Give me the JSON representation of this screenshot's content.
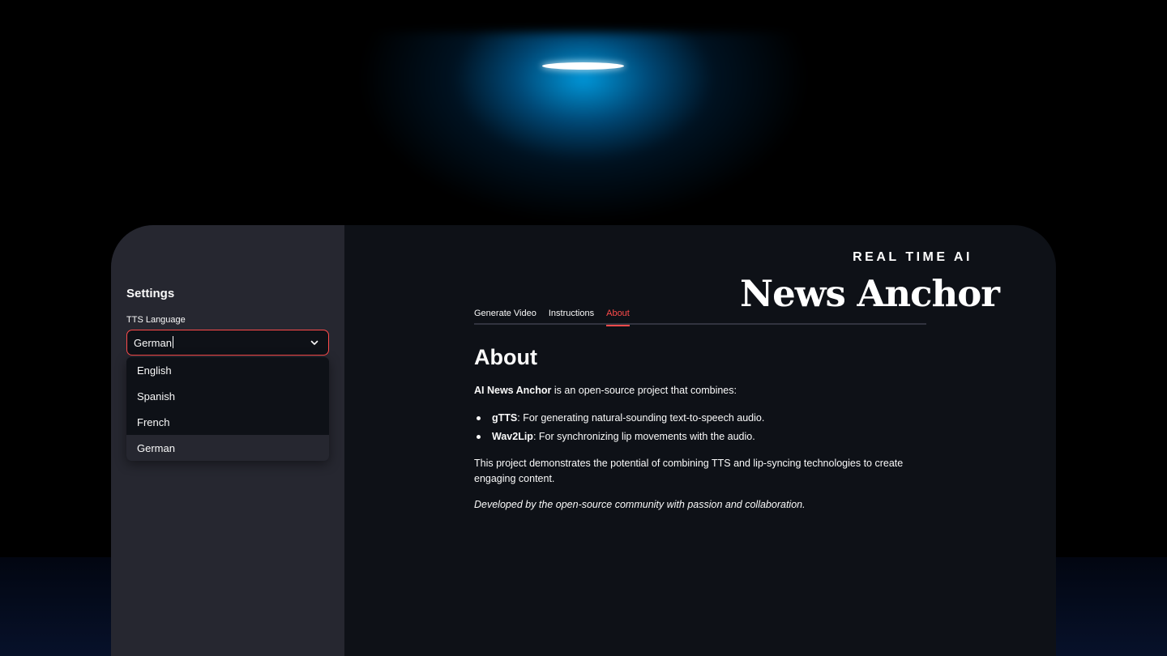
{
  "brand": {
    "kicker": "REAL TIME AI",
    "title": "News Anchor"
  },
  "sidebar": {
    "title": "Settings",
    "select": {
      "label": "TTS Language",
      "value": "German",
      "options": [
        {
          "label": "English",
          "selected": false
        },
        {
          "label": "Spanish",
          "selected": false
        },
        {
          "label": "French",
          "selected": false
        },
        {
          "label": "German",
          "selected": true
        }
      ]
    }
  },
  "tabs": [
    {
      "label": "Generate Video",
      "active": false
    },
    {
      "label": "Instructions",
      "active": false
    },
    {
      "label": "About",
      "active": true
    }
  ],
  "about": {
    "heading": "About",
    "intro_bold": "AI News Anchor",
    "intro_rest": " is an open-source project that combines:",
    "items": [
      {
        "bold": "gTTS",
        "text": ": For generating natural-sounding text-to-speech audio."
      },
      {
        "bold": "Wav2Lip",
        "text": ": For synchronizing lip movements with the audio."
      }
    ],
    "summary": "This project demonstrates the potential of combining TTS and lip-syncing technologies to create engaging content.",
    "credit": "Developed by the open-source community with passion and collaboration."
  },
  "colors": {
    "accent": "#ff4b4b",
    "sidebar_bg": "#262730",
    "main_bg": "#0e1117",
    "spotlight": "#0aa0e6"
  },
  "icons": {
    "select_toggle": "chevron-down-icon"
  }
}
